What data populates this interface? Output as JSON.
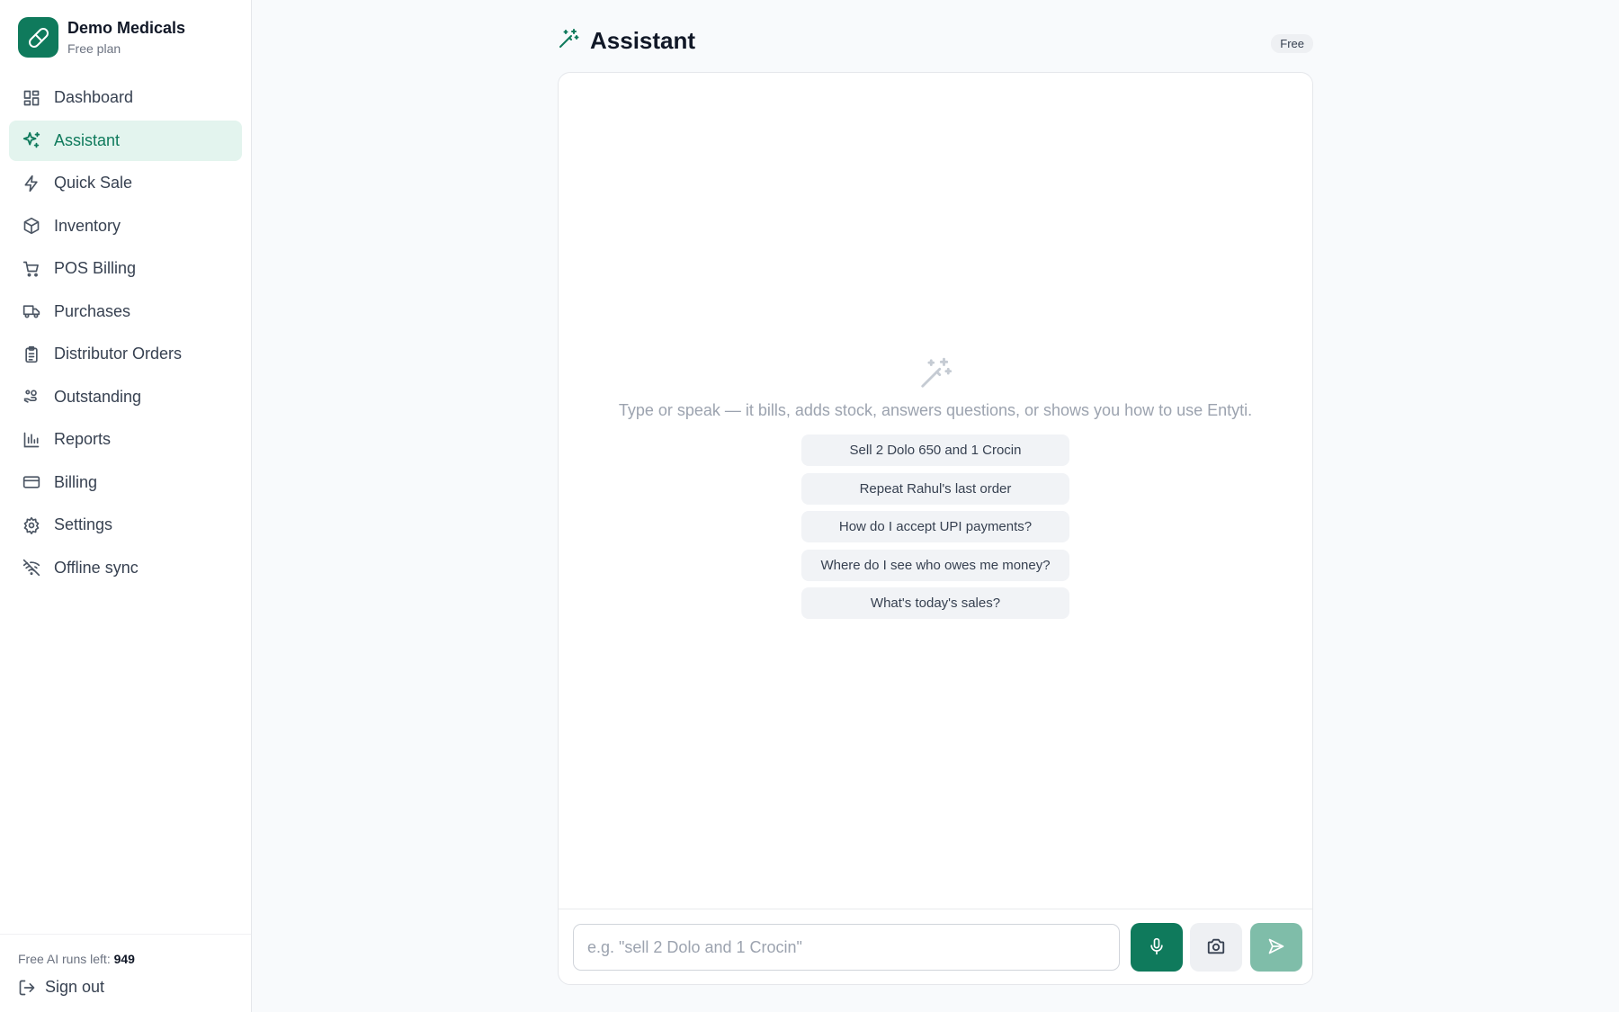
{
  "brand": {
    "name": "Demo Medicals",
    "plan": "Free plan"
  },
  "nav": [
    {
      "label": "Dashboard",
      "icon": "dashboard-icon",
      "active": false
    },
    {
      "label": "Assistant",
      "icon": "sparkles-icon",
      "active": true
    },
    {
      "label": "Quick Sale",
      "icon": "lightning-icon",
      "active": false
    },
    {
      "label": "Inventory",
      "icon": "package-icon",
      "active": false
    },
    {
      "label": "POS Billing",
      "icon": "cart-icon",
      "active": false
    },
    {
      "label": "Purchases",
      "icon": "truck-icon",
      "active": false
    },
    {
      "label": "Distributor Orders",
      "icon": "clipboard-icon",
      "active": false
    },
    {
      "label": "Outstanding",
      "icon": "hand-coins-icon",
      "active": false
    },
    {
      "label": "Reports",
      "icon": "bar-chart-icon",
      "active": false
    },
    {
      "label": "Billing",
      "icon": "credit-card-icon",
      "active": false
    },
    {
      "label": "Settings",
      "icon": "gear-icon",
      "active": false
    },
    {
      "label": "Offline sync",
      "icon": "wifi-off-icon",
      "active": false
    }
  ],
  "footer": {
    "runs_label": "Free AI runs left:",
    "runs_value": "949",
    "signout": "Sign out"
  },
  "header": {
    "title": "Assistant",
    "badge": "Free"
  },
  "empty": {
    "text": "Type or speak — it bills, adds stock, answers questions, or shows you how to use Entyti."
  },
  "suggestions": [
    "Sell 2 Dolo 650 and 1 Crocin",
    "Repeat Rahul's last order",
    "How do I accept UPI payments?",
    "Where do I see who owes me money?",
    "What's today's sales?"
  ],
  "composer": {
    "placeholder": "e.g. \"sell 2 Dolo and 1 Crocin\"",
    "value": ""
  },
  "colors": {
    "accent": "#0f7a5c",
    "active_bg": "#e3f4ee",
    "send_disabled": "#7fbda9"
  }
}
